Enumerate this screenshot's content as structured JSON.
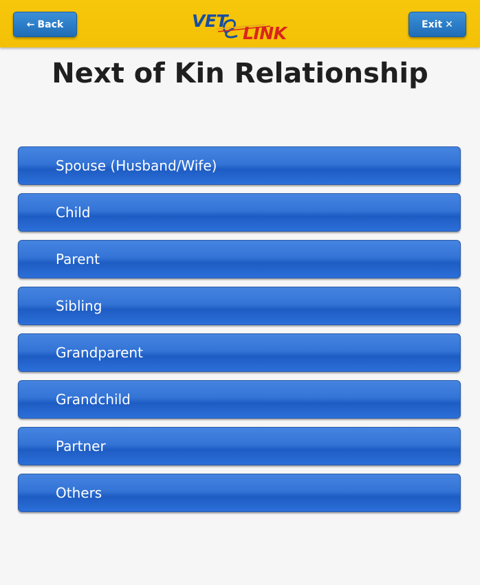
{
  "header": {
    "back_label": "Back",
    "back_icon": "←",
    "exit_label": "Exit",
    "exit_icon": "✕",
    "logo": {
      "part1": "VET",
      "part2": "LINK"
    },
    "colors": {
      "bar": "#f5c30a",
      "button": "#2d7fc9"
    }
  },
  "page": {
    "title": "Next of Kin Relationship"
  },
  "options": [
    {
      "label": "Spouse (Husband/Wife)"
    },
    {
      "label": "Child"
    },
    {
      "label": "Parent"
    },
    {
      "label": "Sibling"
    },
    {
      "label": "Grandparent"
    },
    {
      "label": "Grandchild"
    },
    {
      "label": "Partner"
    },
    {
      "label": "Others"
    }
  ],
  "colors": {
    "option_button": "#3474d6",
    "title_text": "#1f1f1f",
    "background": "#f6f6f6"
  }
}
